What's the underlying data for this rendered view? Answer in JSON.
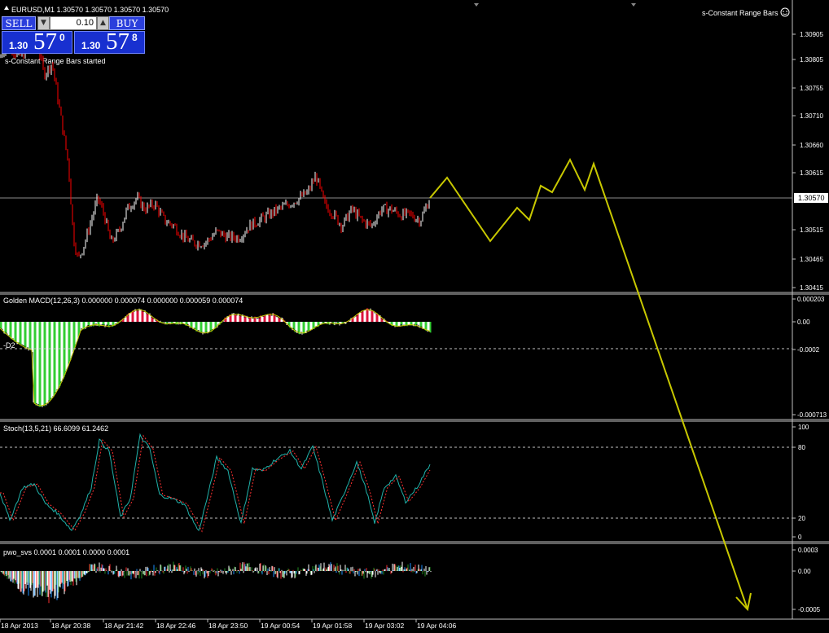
{
  "window": {
    "symbol_title": "EURUSD,M1  1.30570 1.30570 1.30570 1.30570",
    "indicator_title": "s-Constant Range Bars",
    "started_message": "s-Constant Range Bars started"
  },
  "trade_panel": {
    "sell_label": "SELL",
    "buy_label": "BUY",
    "lot_value": "0.10",
    "bid": {
      "prefix": "1.30",
      "big": "57",
      "sup": "0"
    },
    "ask": {
      "prefix": "1.30",
      "big": "57",
      "sup": "8"
    }
  },
  "colors": {
    "background": "#000000",
    "bull_candle": "#ffffff",
    "bear_candle": "#ff0000",
    "forecast_line": "#c8c800",
    "macd_up": "#32cd32",
    "macd_down": "#dc143c",
    "grid": "#c0c0c0"
  },
  "main_axis": {
    "ticks": [
      "1.30905",
      "1.30805",
      "1.30755",
      "1.30710",
      "1.30660",
      "1.30615",
      "1.30515",
      "1.30465",
      "1.30415"
    ],
    "current_price": "1.30570"
  },
  "macd": {
    "label": "Golden MACD(12,26,3) 0.000000 0.000074 0.000000 0.000059 0.000074",
    "extra_label": "-D2",
    "axis_ticks": [
      "0.000203",
      "0.00",
      "-0.0002",
      "-0.000713"
    ]
  },
  "stoch": {
    "label": "Stoch(13,5,21) 66.6099 61.2462",
    "axis_ticks": [
      "100",
      "80",
      "20",
      "0"
    ]
  },
  "pwo": {
    "label": "pwo_svs 0.0001 0.0001 0.0000 0.0001",
    "axis_ticks": [
      "0.0003",
      "0.00",
      "-0.0005"
    ]
  },
  "time_axis": [
    "18 Apr 2013",
    "18 Apr 20:38",
    "18 Apr 21:42",
    "18 Apr 22:46",
    "18 Apr 23:50",
    "19 Apr 00:54",
    "19 Apr 01:58",
    "19 Apr 03:02",
    "19 Apr 04:06"
  ],
  "chart_data": {
    "type": "line",
    "title": "EURUSD,M1  1.30570 1.30570 1.30570 1.30570",
    "y_ticks": [
      1.30905,
      1.30805,
      1.30755,
      1.3071,
      1.3066,
      1.30615,
      1.30515,
      1.30465,
      1.30415
    ],
    "current_price": 1.3057,
    "price_anchors": [
      [
        0,
        1.3082
      ],
      [
        10,
        1.3085
      ],
      [
        22,
        1.3082
      ],
      [
        32,
        1.3083
      ],
      [
        44,
        1.3086
      ],
      [
        54,
        1.3079
      ],
      [
        64,
        1.3081
      ],
      [
        74,
        1.3072
      ],
      [
        84,
        1.3063
      ],
      [
        90,
        1.305
      ],
      [
        96,
        1.3046
      ],
      [
        104,
        1.3049
      ],
      [
        112,
        1.3053
      ],
      [
        120,
        1.3057
      ],
      [
        128,
        1.3054
      ],
      [
        136,
        1.3049
      ],
      [
        146,
        1.3051
      ],
      [
        156,
        1.3055
      ],
      [
        168,
        1.3057
      ],
      [
        178,
        1.3055
      ],
      [
        190,
        1.3056
      ],
      [
        202,
        1.3053
      ],
      [
        214,
        1.3052
      ],
      [
        226,
        1.305
      ],
      [
        238,
        1.3049
      ],
      [
        252,
        1.3049
      ],
      [
        266,
        1.3051
      ],
      [
        280,
        1.305
      ],
      [
        294,
        1.305
      ],
      [
        306,
        1.3052
      ],
      [
        318,
        1.3053
      ],
      [
        330,
        1.3054
      ],
      [
        342,
        1.3055
      ],
      [
        356,
        1.3056
      ],
      [
        368,
        1.3057
      ],
      [
        378,
        1.3058
      ],
      [
        388,
        1.3061
      ],
      [
        398,
        1.3056
      ],
      [
        410,
        1.3054
      ],
      [
        420,
        1.3052
      ],
      [
        432,
        1.3055
      ],
      [
        444,
        1.3053
      ],
      [
        456,
        1.3052
      ],
      [
        468,
        1.3055
      ],
      [
        480,
        1.3055
      ],
      [
        492,
        1.3054
      ],
      [
        504,
        1.3054
      ],
      [
        516,
        1.3053
      ],
      [
        528,
        1.3057
      ]
    ],
    "forecast_prices": [
      1.3057,
      1.3062,
      1.3051,
      1.306,
      1.3058,
      1.3063,
      1.3065,
      1.3063,
      1.3064
    ]
  }
}
